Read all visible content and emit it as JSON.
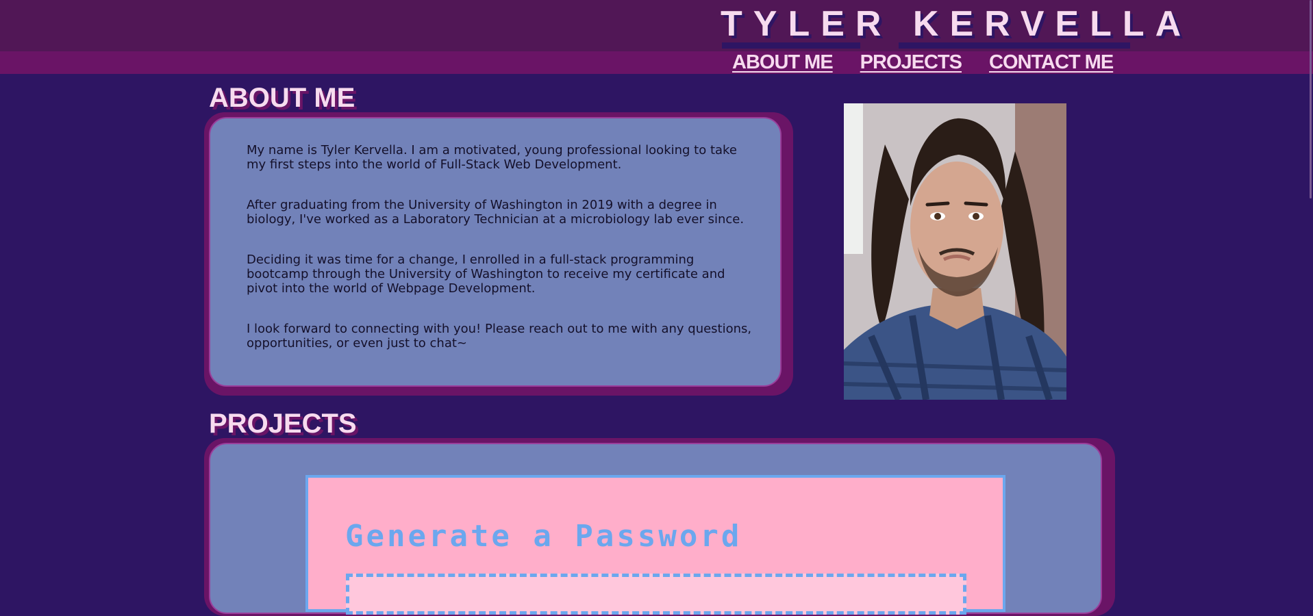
{
  "header": {
    "site_title": "TYLER KERVELLA",
    "nav": [
      {
        "label": "ABOUT ME"
      },
      {
        "label": "PROJECTS"
      },
      {
        "label": "CONTACT ME"
      }
    ]
  },
  "about": {
    "heading": "ABOUT ME",
    "paragraphs": [
      "My name is Tyler Kervella. I am a motivated, young professional looking to take my first steps into the world of Full-Stack Web Development.",
      "After graduating from the University of Washington in 2019 with a degree in biology, I've worked as a Laboratory Technician at a microbiology lab ever since.",
      "Deciding it was time for a change, I enrolled in a full-stack programming bootcamp through the University of Washington to receive my certificate and pivot into the world of Webpage Development.",
      "I look forward to connecting with you! Please reach out to me with any questions, opportunities, or even just to chat~"
    ]
  },
  "projects": {
    "heading": "PROJECTS",
    "items": [
      {
        "title": "Generate a Password"
      }
    ]
  },
  "colors": {
    "page_background": "#2e1563",
    "header_background": "#511756",
    "nav_background": "#6a1466",
    "card_background": "#7282b9",
    "text_light": "#f7dbef",
    "project_background": "#ffaeca",
    "project_accent": "#6ba7ee"
  }
}
